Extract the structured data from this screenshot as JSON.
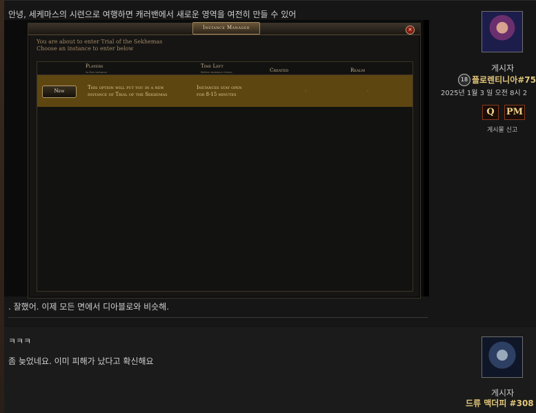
{
  "post1": {
    "text_top": "안녕, 세케마스의 시련으로 여행하면 캐러밴에서 새로운 영역을 여전히 만들 수 있어",
    "text_bottom": ". 잘했어. 이제 모든 면에서 디아블로와 비슷해.",
    "role": "게시자",
    "author": "플로렌티니아#75",
    "level": "18",
    "date": "2025년 1월 3 일 오전 8시 2",
    "quote_label": "Q",
    "pm_label": "PM",
    "report_label": "게시물 신고"
  },
  "dialog": {
    "title": "Instance Manager",
    "close_glyph": "×",
    "message_line1": "You are about to enter Trial of the Sekhemas",
    "message_line2": "Choose an instance to enter below",
    "columns": {
      "players": "Players",
      "players_sub": "In this instance",
      "time_left": "Time Left",
      "time_left_sub": "Before instance closes",
      "created": "Created",
      "realm": "Realm"
    },
    "row": {
      "button": "New",
      "desc_line1": "This option will put you in a new",
      "desc_line2": "instance of Trial of the Sekhemas",
      "time_line1": "Instances stay open",
      "time_line2": "for 8-15 minutes",
      "created": "-",
      "realm": "-"
    }
  },
  "post2": {
    "line1": "ㅋㅋㅋ",
    "line2": "좀 늦었네요. 이미 피해가 났다고 확신해요",
    "role": "게시자",
    "author": "드류 맥더피 #308"
  },
  "colors": {
    "accent_gold": "#e4c77b",
    "row_highlight": "#5e4611",
    "background": "#121212"
  }
}
